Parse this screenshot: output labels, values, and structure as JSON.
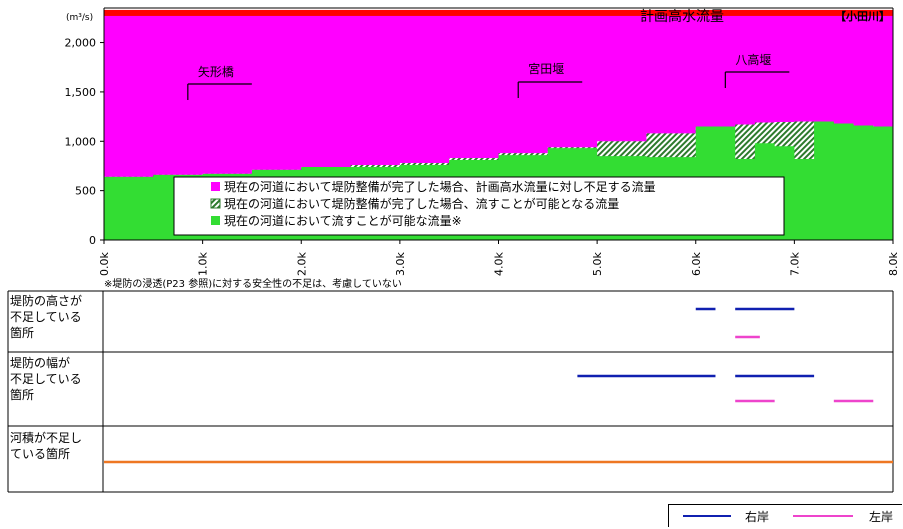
{
  "chart_data": {
    "type": "area",
    "title": "計画高水流量",
    "river_label": "【小田川】",
    "yunit": "(m³/s)",
    "ylim": [
      0,
      2350
    ],
    "yticks": [
      0,
      500,
      1000,
      1500,
      2000
    ],
    "ytick_labels": [
      "0",
      "500",
      "1,000",
      "1,500",
      "2,000"
    ],
    "xlim": [
      0,
      8.0
    ],
    "xticks": [
      0,
      1,
      2,
      3,
      4,
      5,
      6,
      7,
      8
    ],
    "xtick_labels": [
      "0.0k",
      "1.0k",
      "2.0k",
      "3.0k",
      "4.0k",
      "5.0k",
      "6.0k",
      "7.0k",
      "8.0k"
    ],
    "planned_flow": 2300,
    "series": [
      {
        "name": "現在の河道において堤防整備が完了した場合、計画高水流量に対し不足する流量",
        "color": "#ff00ff",
        "marker": "■"
      },
      {
        "name": "現在の河道において堤防整備が完了した場合、流すことが可能となる流量",
        "color": "#2d8a2d",
        "marker": "▧",
        "x": [
          0,
          0.5,
          1.0,
          1.5,
          2.0,
          2.5,
          3.0,
          3.5,
          4.0,
          4.5,
          5.0,
          5.5,
          6.0,
          6.2,
          6.4,
          6.6,
          6.8,
          7.0,
          7.2,
          7.4,
          7.6,
          7.8,
          8.0
        ],
        "values": [
          640,
          660,
          670,
          710,
          740,
          760,
          780,
          830,
          880,
          940,
          1000,
          1080,
          1140,
          1150,
          1170,
          1190,
          1195,
          1200,
          1195,
          1180,
          1160,
          1150,
          1350
        ]
      },
      {
        "name": "現在の河道において流すことが可能な流量※",
        "color": "#33dd33",
        "marker": "■",
        "x": [
          0,
          0.5,
          1.0,
          1.5,
          2.0,
          2.5,
          3.0,
          3.5,
          4.0,
          4.5,
          5.0,
          5.5,
          6.0,
          6.2,
          6.4,
          6.6,
          6.8,
          7.0,
          7.2,
          7.4,
          7.6,
          7.8,
          8.0
        ],
        "values": [
          640,
          660,
          670,
          710,
          740,
          740,
          760,
          810,
          860,
          930,
          850,
          840,
          1150,
          1150,
          820,
          980,
          950,
          820,
          1200,
          1180,
          1160,
          1150,
          1350
        ]
      }
    ],
    "annotations": [
      {
        "text": "矢形橋",
        "x": 0.85
      },
      {
        "text": "宮田堰",
        "x": 4.2
      },
      {
        "text": "八高堰",
        "x": 6.3
      }
    ],
    "footnote": "※堤防の浸透(P23 参照)に対する安全性の不足は、考慮していない"
  },
  "panels": [
    {
      "label": "堤防の高さが\n不足している\n箇所",
      "segments": [
        {
          "side": "右岸",
          "from": 6.0,
          "to": 6.2
        },
        {
          "side": "右岸",
          "from": 6.4,
          "to": 7.0
        },
        {
          "side": "左岸",
          "from": 6.4,
          "to": 6.65
        }
      ]
    },
    {
      "label": "堤防の幅が\n不足している\n箇所",
      "segments": [
        {
          "side": "右岸",
          "from": 4.8,
          "to": 6.2
        },
        {
          "side": "右岸",
          "from": 6.4,
          "to": 7.2
        },
        {
          "side": "左岸",
          "from": 6.4,
          "to": 6.8
        },
        {
          "side": "左岸",
          "from": 7.4,
          "to": 7.8
        }
      ]
    },
    {
      "label": "河積が不足し\nている箇所",
      "segments": [
        {
          "side": "all",
          "from": 0.0,
          "to": 8.0
        }
      ]
    }
  ],
  "bottom_legend": {
    "right_bank": "右岸",
    "left_bank": "左岸"
  },
  "colors": {
    "right_bank": "#1020b0",
    "left_bank": "#ee44cc",
    "all_bank": "#ee7722",
    "planned_flow": "#ff0000"
  }
}
